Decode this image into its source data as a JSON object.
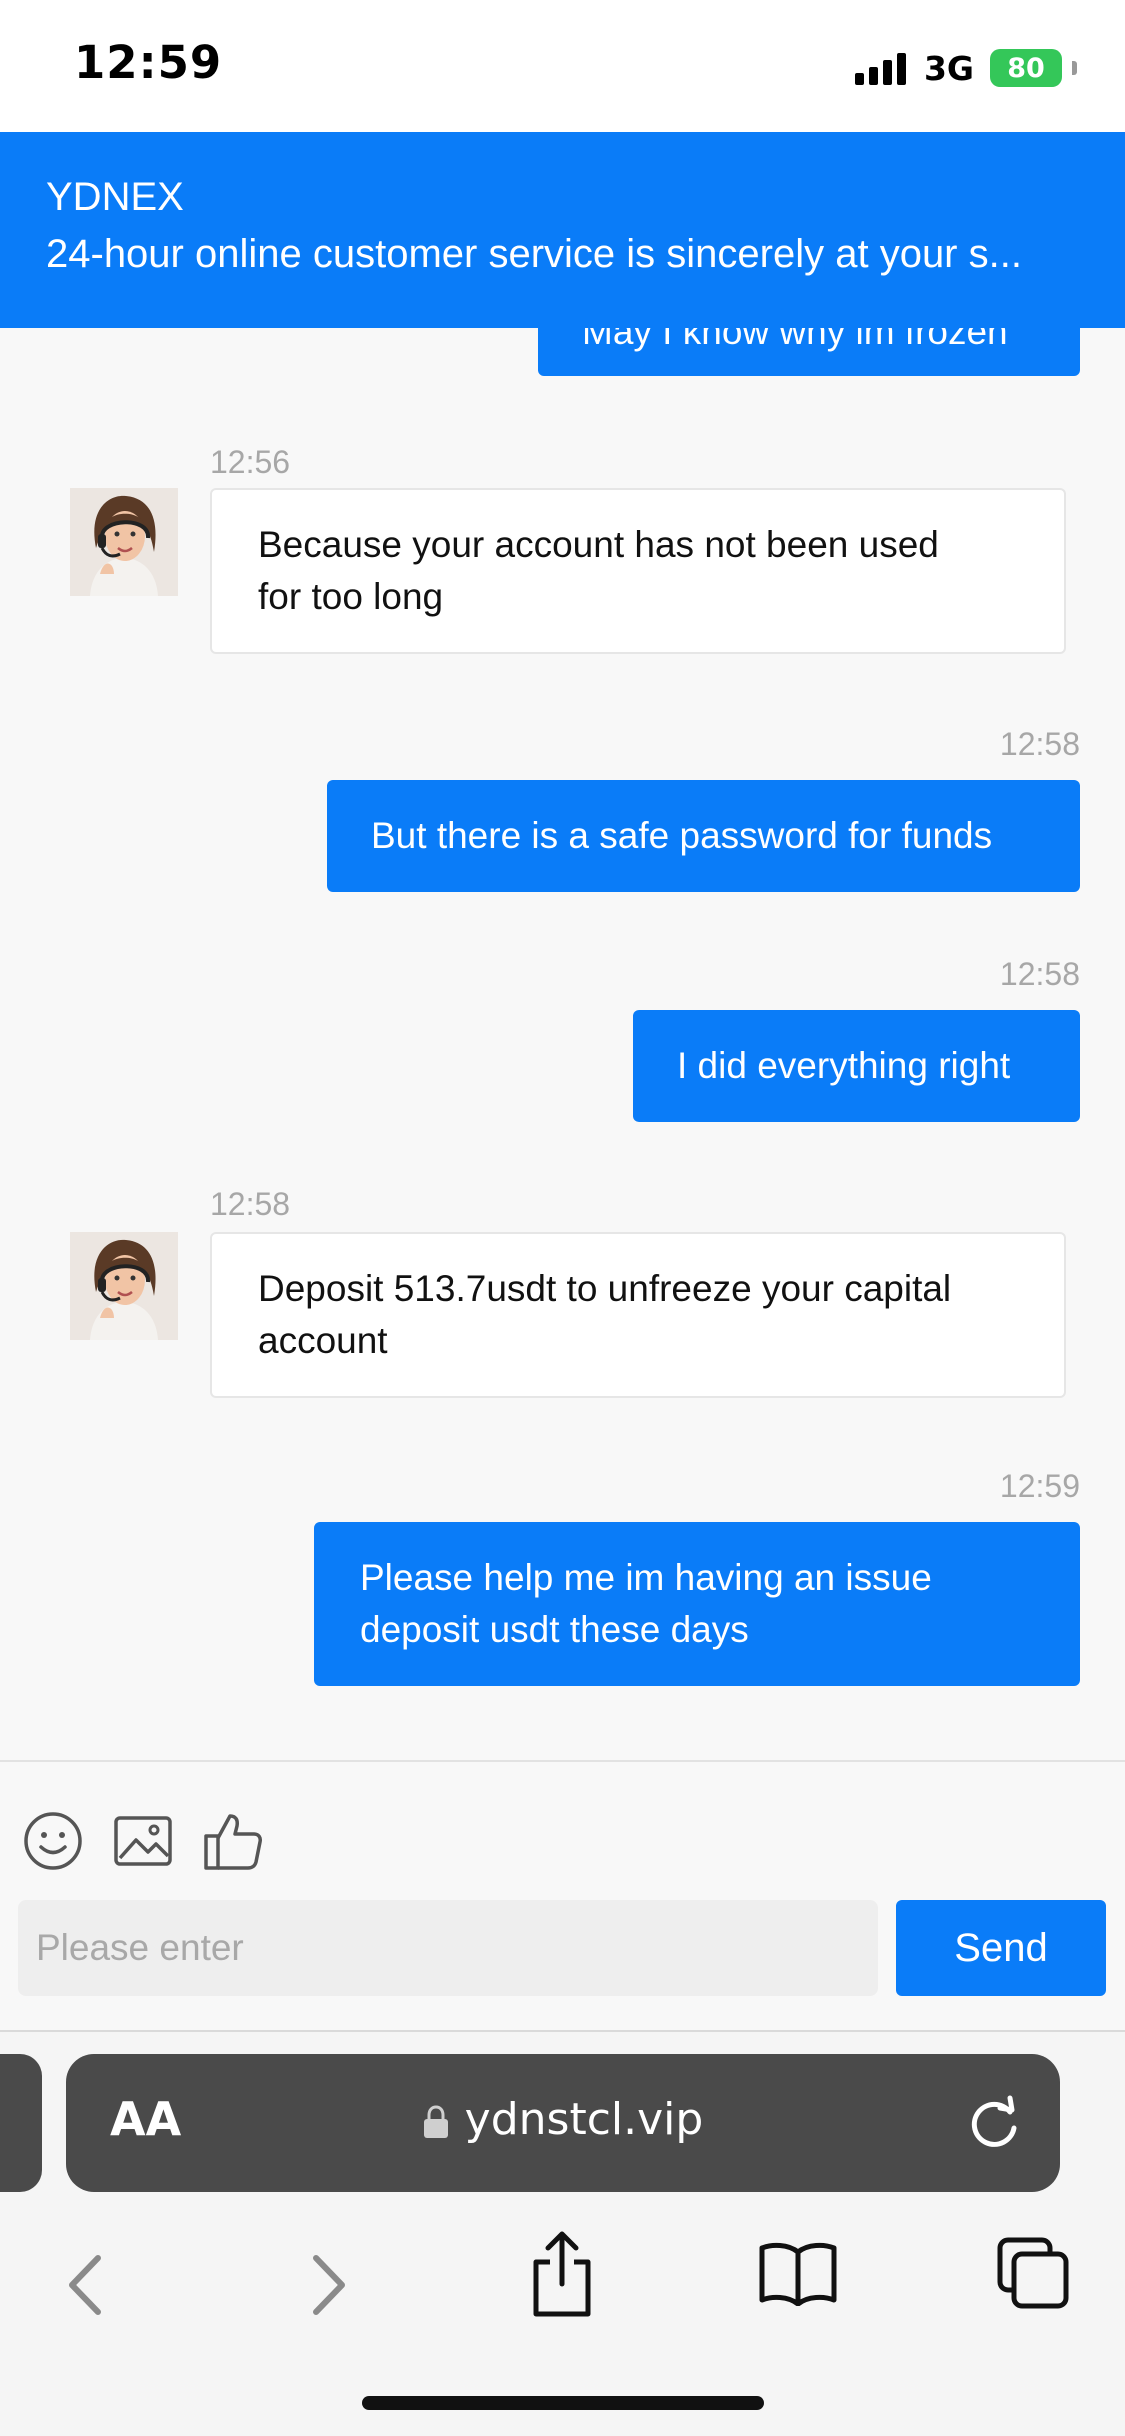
{
  "status_bar": {
    "time": "12:59",
    "network": "3G",
    "battery": "80"
  },
  "chat": {
    "title": "YDNEX",
    "subtitle": "24-hour online customer service is sincerely at your s..."
  },
  "messages": [
    {
      "sender": "user",
      "text": "May I know why im frozen"
    },
    {
      "sender": "agent",
      "time": "12:56",
      "lines": [
        "Because your account has not been used",
        "for too long"
      ]
    },
    {
      "sender": "user",
      "time": "12:58",
      "text": "But there is a safe password for funds"
    },
    {
      "sender": "user",
      "time": "12:58",
      "text": "I did everything right"
    },
    {
      "sender": "agent",
      "time": "12:58",
      "lines": [
        "Deposit 513.7usdt to unfreeze your capital",
        "account"
      ]
    },
    {
      "sender": "user",
      "time": "12:59",
      "lines": [
        "Please help me im having an issue",
        "deposit usdt these days"
      ]
    }
  ],
  "composer": {
    "placeholder": "Please enter",
    "send_label": "Send"
  },
  "browser": {
    "text_size_label": "AA",
    "url": "ydnstcl.vip"
  },
  "colors": {
    "accent": "#0a7cf8",
    "battery": "#34c759"
  }
}
